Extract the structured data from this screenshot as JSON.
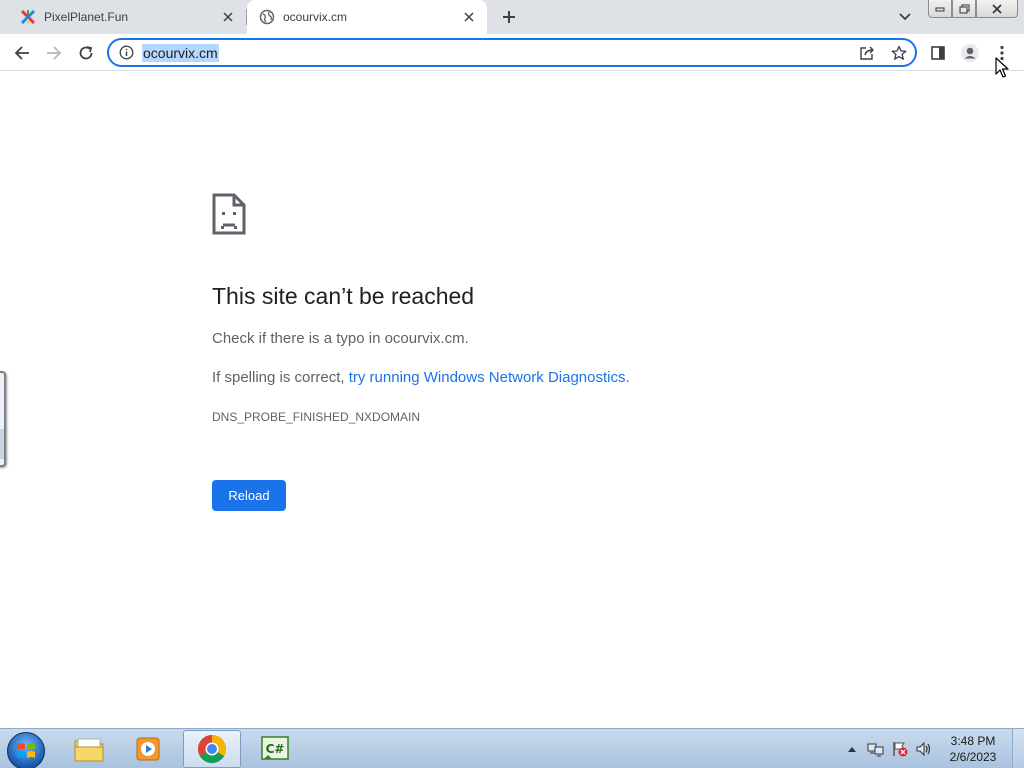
{
  "browser": {
    "tabs": [
      {
        "title": "PixelPlanet.Fun",
        "icon": "pixelplanet-favicon",
        "active": false
      },
      {
        "title": "ocourvix.cm",
        "icon": "globe-icon",
        "active": true
      }
    ],
    "address_bar": {
      "url": "ocourvix.cm",
      "selected": true
    }
  },
  "error_page": {
    "title": "This site can’t be reached",
    "line1": "Check if there is a typo in ocourvix.cm.",
    "line2_prefix": "If spelling is correct, ",
    "line2_link": "try running Windows Network Diagnostics",
    "line2_suffix": ".",
    "error_code": "DNS_PROBE_FINISHED_NXDOMAIN",
    "reload_label": "Reload"
  },
  "taskbar": {
    "apps": [
      "windows-explorer",
      "media-player",
      "google-chrome",
      "csharp-ide"
    ],
    "active_app": "google-chrome",
    "clock": {
      "time": "3:48 PM",
      "date": "2/6/2023"
    }
  },
  "colors": {
    "accent": "#1a73e8",
    "tabstrip": "#dee1e6",
    "text_secondary": "#5f6368"
  }
}
